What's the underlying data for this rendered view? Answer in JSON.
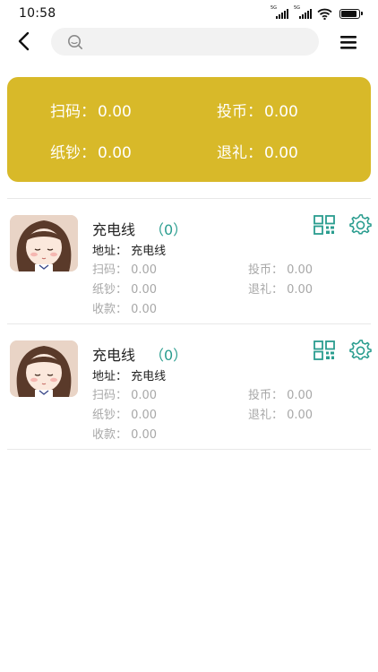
{
  "status_bar": {
    "time": "10:58",
    "sim1_tag": "5G",
    "sim2_tag": "5G",
    "battery_level_percent": 90
  },
  "header": {
    "search_placeholder": "",
    "search_value": ""
  },
  "summary": {
    "scan_label": "扫码：",
    "scan_value": "0.00",
    "coin_label": "投币：",
    "coin_value": "0.00",
    "paper_label": "纸钞：",
    "paper_value": "0.00",
    "refund_label": "退礼：",
    "refund_value": "0.00"
  },
  "devices": [
    {
      "name": "充电线",
      "count": "（0）",
      "address": "地址：  充电线",
      "scan": "扫码：  0.00",
      "coin": "投币：  0.00",
      "paper": "纸钞：  0.00",
      "refund": "退礼：  0.00",
      "income": "收款：  0.00"
    },
    {
      "name": "充电线",
      "count": "（0）",
      "address": "地址：  充电线",
      "scan": "扫码：  0.00",
      "coin": "投币：  0.00",
      "paper": "纸钞：  0.00",
      "refund": "退礼：  0.00",
      "income": "收款：  0.00"
    }
  ],
  "colors": {
    "summary_bg": "#d8b929",
    "accent_teal": "#2a9d8f",
    "stat_gray": "#a8a8a8"
  },
  "icons": {
    "back": "back-arrow-icon",
    "search": "search-icon",
    "menu": "menu-icon",
    "qr": "qr-code-icon",
    "settings": "gear-icon"
  }
}
